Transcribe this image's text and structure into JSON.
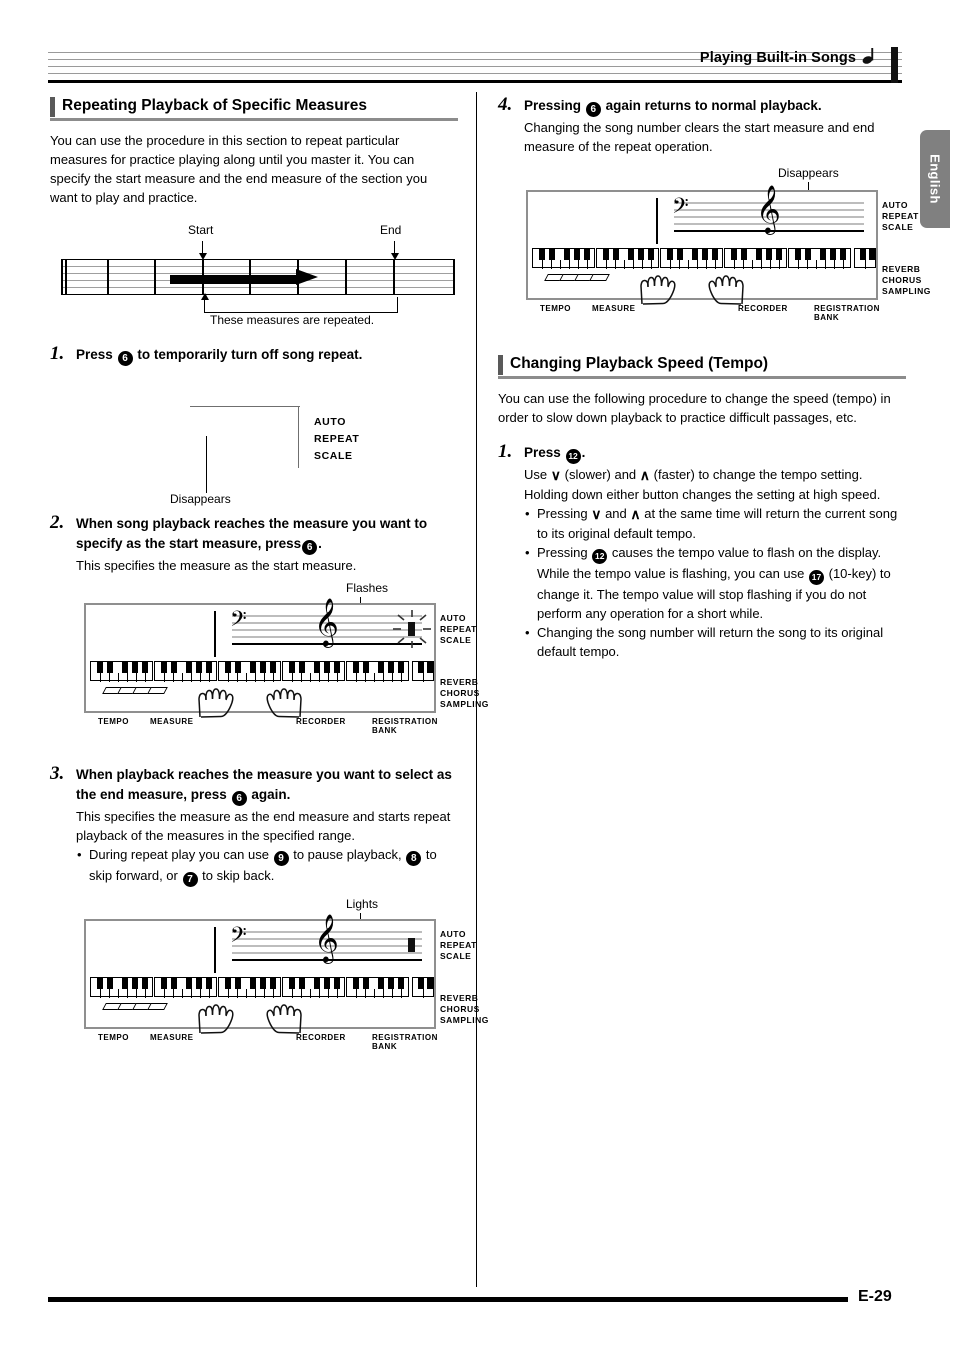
{
  "header": {
    "title": "Playing Built-in Songs",
    "note_icon": "music-note-icon"
  },
  "language_tab": {
    "label": "English"
  },
  "footer": {
    "page_number": "E-29"
  },
  "left_column": {
    "section": {
      "heading": "Repeating Playback of Specific Measures",
      "intro": "You can use the procedure in this section to repeat particular measures for practice playing along until you master it. You can specify the start measure and the end measure of the section you want to play and practice."
    },
    "repeat_figure": {
      "start_label": "Start",
      "end_label": "End",
      "caption": "These measures are repeated."
    },
    "step1": {
      "number": "1.",
      "heading_pre": "Press",
      "button": "6",
      "heading_post": "to temporarily turn off song repeat.",
      "callout": "Disappears",
      "indicators": [
        "AUTO",
        "REPEAT",
        "SCALE"
      ]
    },
    "step2": {
      "number": "2.",
      "heading_pre": "When song playback reaches the measure you want to specify as the start measure, press",
      "button": "6",
      "heading_post": ".",
      "body": "This specifies the measure as the start measure.",
      "callout": "Flashes"
    },
    "step3": {
      "number": "3.",
      "heading_pre": "When playback reaches the measure you want to select as the end measure, press",
      "button": "6",
      "heading_post": "again.",
      "body": "This specifies the measure as the end measure and starts repeat playback of the measures in the specified range.",
      "bullet_1_a": "During repeat play you can use",
      "bullet_1_b1": "9",
      "bullet_1_c": "to pause playback,",
      "bullet_1_b2": "8",
      "bullet_1_d": "to skip forward, or",
      "bullet_1_b3": "7",
      "bullet_1_e": "to skip back.",
      "callout": "Lights"
    }
  },
  "right_column": {
    "step4": {
      "number": "4.",
      "heading_pre": "Pressing",
      "button": "6",
      "heading_post": "again returns to normal playback.",
      "body": "Changing the song number clears the start measure and end measure of the repeat operation.",
      "callout": "Disappears"
    },
    "section": {
      "heading": "Changing Playback Speed (Tempo)",
      "intro": "You can use the following procedure to change the speed (tempo) in order to slow down playback to practice difficult passages, etc."
    },
    "step1": {
      "number": "1.",
      "heading_pre": "Press",
      "button": "12",
      "heading_post": ".",
      "body_a": "Use",
      "down_arrow": "∨",
      "body_b": "(slower) and",
      "up_arrow": "∧",
      "body_c": "(faster) to change the tempo setting. Holding down either button changes the setting at high speed.",
      "bullets": [
        {
          "a": "Pressing",
          "arrow1": "∨",
          "b": "and",
          "arrow2": "∧",
          "c": "at the same time will return the current song to its original default tempo."
        },
        {
          "a": "Pressing",
          "button1": "12",
          "b": "causes the tempo value to flash on the display. While the tempo value is flashing, you can use",
          "button2": "17",
          "c": "(10-key) to change it. The tempo value will stop flashing if you do not perform any operation for a short while."
        },
        {
          "text": "Changing the song number will return the song to its original default tempo."
        }
      ]
    }
  },
  "lcd_display": {
    "right_indicators_top": [
      "AUTO",
      "REPEAT",
      "SCALE"
    ],
    "right_indicators_bottom": [
      "REVERB",
      "CHORUS",
      "SAMPLING"
    ],
    "bottom_labels": {
      "tempo": "TEMPO",
      "measure": "MEASURE",
      "recorder": "RECORDER",
      "registration_bank_1": "REGISTRATION",
      "registration_bank_2": "BANK"
    },
    "bass_clef_icon": "bass-clef-icon",
    "treble_clef_icon": "treble-clef-icon",
    "hand_icon": "hand-icon"
  },
  "colors": {
    "tab_gray": "#808080",
    "heading_bar": "#595959",
    "heading_rule": "#8c8c8c",
    "lcd_border": "#8f8f8f",
    "staff_gray": "#bdbdbd"
  }
}
